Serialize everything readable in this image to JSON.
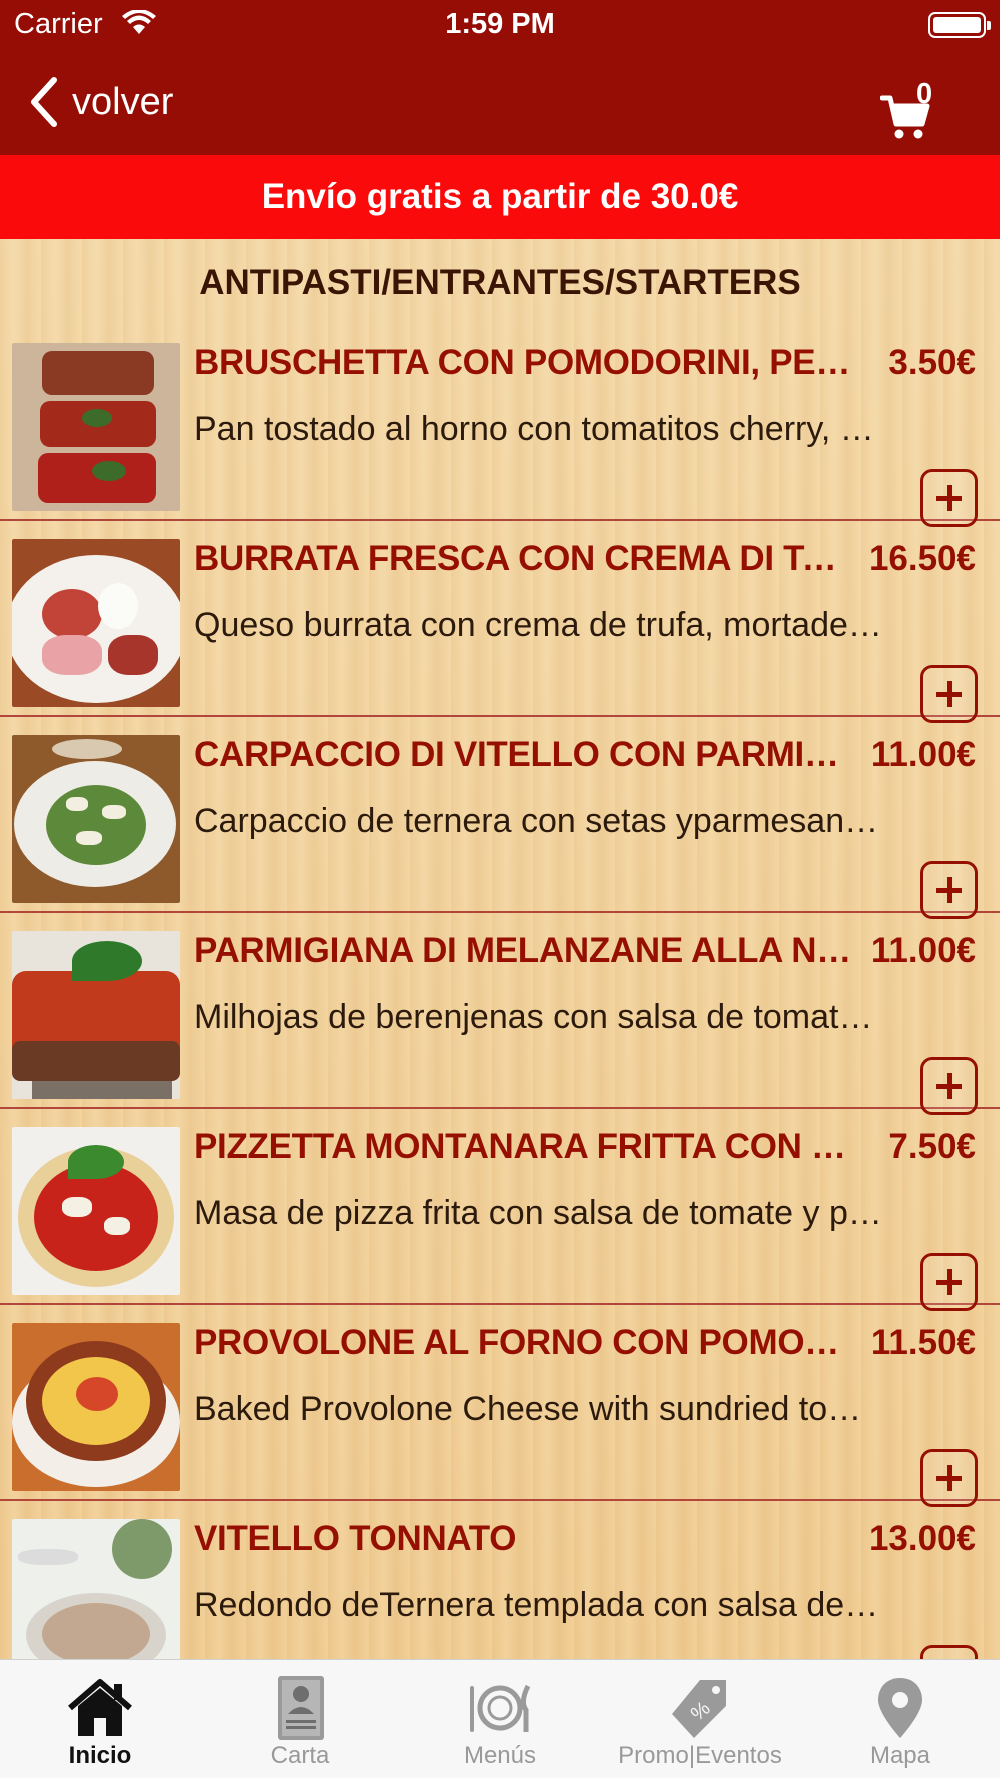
{
  "status_bar": {
    "carrier": "Carrier",
    "time": "1:59 PM"
  },
  "nav": {
    "back_label": "volver",
    "cart_count": "0"
  },
  "banner": "Envío gratis a partir de 30.0€",
  "section_title": "ANTIPASTI/ENTRANTES/STARTERS",
  "items": [
    {
      "name": "BRUSCHETTA CON POMODORINI, PESTO...",
      "price": "3.50€",
      "desc": "Pan tostado al horno con tomatitos cherry, pe…"
    },
    {
      "name": "BURRATA FRESCA CON CREMA DI TARTU...",
      "price": "16.50€",
      "desc": "Queso burrata con crema de trufa, mortadela…"
    },
    {
      "name": "CARPACCIO DI VITELLO CON PARMIGIA...",
      "price": "11.00€",
      "desc": "Carpaccio de ternera con setas yparmesano, y…"
    },
    {
      "name": "PARMIGIANA DI MELANZANE ALLA NAP...",
      "price": "11.00€",
      "desc": "Milhojas de berenjenas con salsa de tomate,…"
    },
    {
      "name": "PIZZETTA MONTANARA FRITTA CON SAL...",
      "price": "7.50€",
      "desc": "Masa de pizza frita con salsa de tomate y par…"
    },
    {
      "name": "PROVOLONE AL FORNO CON POMODOR...",
      "price": "11.50€",
      "desc": "Baked Provolone Cheese with sundried tomat…"
    },
    {
      "name": "VITELLO TONNATO",
      "price": "13.00€",
      "desc": "Redondo deTernera templada con salsa de at…"
    }
  ],
  "tabs": [
    {
      "label": "Inicio",
      "icon": "home-icon",
      "active": true
    },
    {
      "label": "Carta",
      "icon": "menu-card-icon"
    },
    {
      "label": "Menús",
      "icon": "plate-cutlery-icon"
    },
    {
      "label": "Promo|Eventos",
      "icon": "tag-percent-icon"
    },
    {
      "label": "Mapa",
      "icon": "map-pin-icon"
    }
  ],
  "colors": {
    "header": "#950d04",
    "banner": "#fa0a0a",
    "accent": "#951003",
    "wood": "#f3d5a3"
  }
}
